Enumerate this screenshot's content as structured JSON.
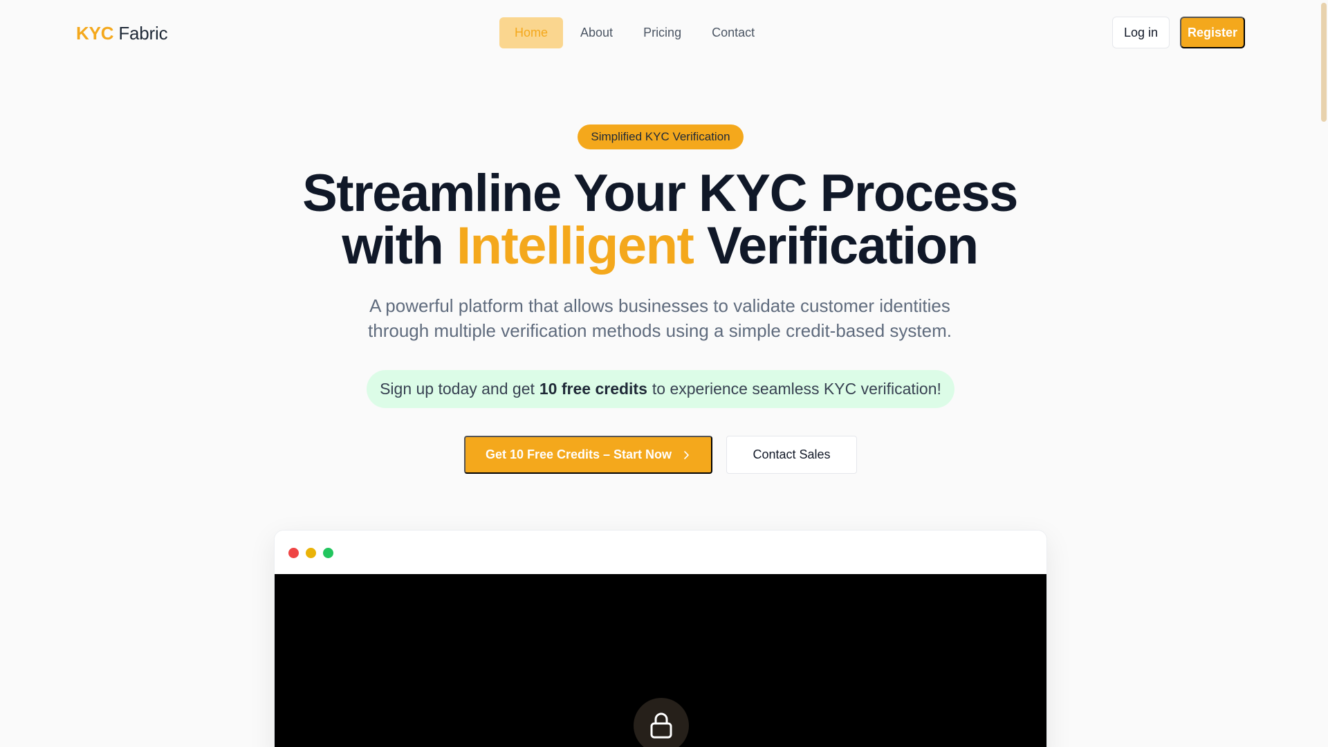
{
  "brand": {
    "logo_accent": "KYC",
    "logo_rest": "Fabric",
    "accent_color": "#f4a81c"
  },
  "nav": {
    "items": [
      {
        "label": "Home",
        "active": true
      },
      {
        "label": "About"
      },
      {
        "label": "Pricing"
      },
      {
        "label": "Contact"
      }
    ]
  },
  "auth": {
    "login_label": "Log in",
    "register_label": "Register"
  },
  "hero": {
    "badge": "Simplified KYC Verification",
    "headline_line1": "Streamline Your KYC Process",
    "headline_line2_pre": "with",
    "headline_line2_accent": "Intelligent",
    "headline_line2_post": "Verification",
    "subtitle_line1": "A powerful platform that allows businesses to validate customer identities",
    "subtitle_line2": "through multiple verification methods using a simple credit-based system.",
    "promo_pre": "Sign up today and get",
    "promo_bold": "10 free credits",
    "promo_post": "to experience seamless KYC verification!",
    "primary_cta": "Get 10 Free Credits – Start Now",
    "primary_cta_icon": "chevron-right-icon",
    "secondary_cta": "Contact Sales"
  },
  "preview": {
    "window_dots": [
      "#ef4444",
      "#eab308",
      "#22c55e"
    ],
    "center_icon": "lock-icon"
  }
}
